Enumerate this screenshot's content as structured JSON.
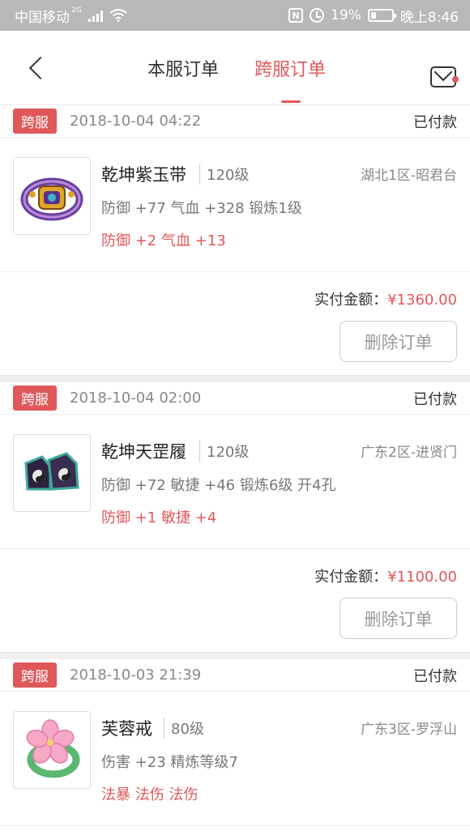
{
  "status_bar": {
    "carrier": "中国移动",
    "network": "2G",
    "battery": "19%",
    "time": "晚上8:46"
  },
  "nav": {
    "tab_local": "本服订单",
    "tab_cross": "跨服订单",
    "accent": "#e0585a"
  },
  "orders": [
    {
      "tag": "跨服",
      "date": "2018-10-04 04:22",
      "status": "已付款",
      "name": "乾坤紫玉带",
      "level": "120级",
      "server": "湖北1区-昭君台",
      "attr1": "防御 +77 气血 +328 锻炼1级",
      "attr2": "防御 +2 气血 +13",
      "pay_label": "实付金额：",
      "amount": "¥1360.00",
      "delete_label": "删除订单",
      "icon": "ring-belt"
    },
    {
      "tag": "跨服",
      "date": "2018-10-04 02:00",
      "status": "已付款",
      "name": "乾坤天罡履",
      "level": "120级",
      "server": "广东2区-进贤门",
      "attr1": "防御 +72 敏捷 +46 锻炼6级 开4孔",
      "attr2": "防御 +1 敏捷 +4",
      "pay_label": "实付金额：",
      "amount": "¥1100.00",
      "delete_label": "删除订单",
      "icon": "boots"
    },
    {
      "tag": "跨服",
      "date": "2018-10-03 21:39",
      "status": "已付款",
      "name": "芙蓉戒",
      "level": "80级",
      "server": "广东3区-罗浮山",
      "attr1": "伤害 +23 精炼等级7",
      "attr2": "法暴 法伤 法伤",
      "icon": "flower-ring"
    }
  ]
}
